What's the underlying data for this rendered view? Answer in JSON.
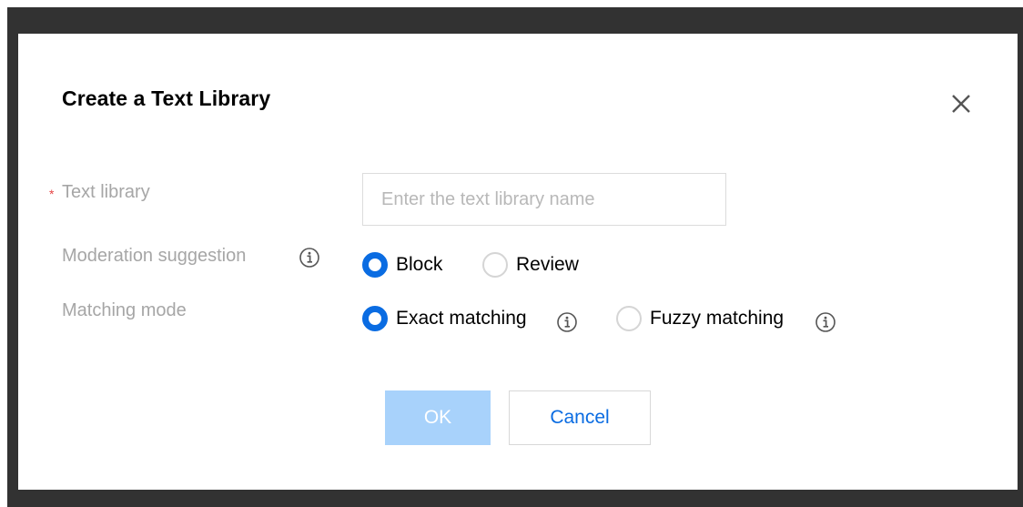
{
  "dialog": {
    "title": "Create a Text Library",
    "close_icon": "close-icon"
  },
  "form": {
    "text_library": {
      "label": "Text library",
      "required_mark": "*",
      "placeholder": "Enter the text library name",
      "value": ""
    },
    "moderation_suggestion": {
      "label": "Moderation suggestion",
      "info_icon": "info-icon",
      "options": [
        {
          "label": "Block",
          "checked": true
        },
        {
          "label": "Review",
          "checked": false
        }
      ]
    },
    "matching_mode": {
      "label": "Matching mode",
      "options": [
        {
          "label": "Exact matching",
          "checked": true,
          "info_icon": "info-icon"
        },
        {
          "label": "Fuzzy matching",
          "checked": false,
          "info_icon": "info-icon"
        }
      ]
    }
  },
  "footer": {
    "ok_label": "OK",
    "cancel_label": "Cancel"
  },
  "colors": {
    "accent": "#0a6ce2",
    "ok_disabled_bg": "#a8d2fb",
    "required": "#e54545",
    "label": "#a6a6a6",
    "overlay": "#323232"
  }
}
